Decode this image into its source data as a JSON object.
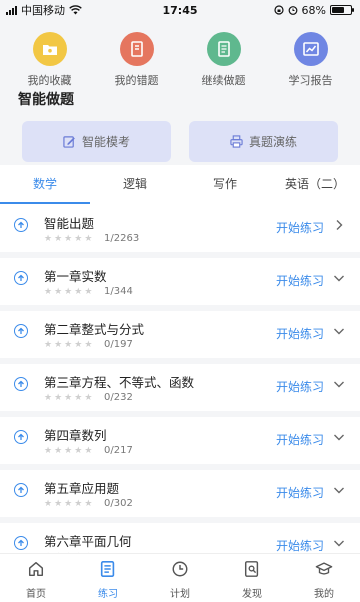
{
  "status_bar": {
    "carrier": "中国移动",
    "time": "17:45",
    "battery": "68%",
    "battery_level": 0.68
  },
  "quick_actions": [
    {
      "label": "我的收藏",
      "icon": "folder-icon",
      "color": "#f2c744"
    },
    {
      "label": "我的错题",
      "icon": "notebook-icon",
      "color": "#e5765f"
    },
    {
      "label": "继续做题",
      "icon": "document-icon",
      "color": "#5fb88e"
    },
    {
      "label": "学习报告",
      "icon": "report-icon",
      "color": "#6f86e3"
    }
  ],
  "section": {
    "title": "智能做题"
  },
  "modes": [
    {
      "label": "智能模考",
      "icon": "edit-icon"
    },
    {
      "label": "真题演练",
      "icon": "printer-icon"
    }
  ],
  "tabs": [
    "数学",
    "逻辑",
    "写作",
    "英语（二）"
  ],
  "active_tab": 0,
  "practice_items": [
    {
      "title": "智能出题",
      "progress": "1/2263",
      "action": "开始练习",
      "arrow": "right"
    },
    {
      "title": "第一章实数",
      "progress": "1/344",
      "action": "开始练习",
      "arrow": "down"
    },
    {
      "title": "第二章整式与分式",
      "progress": "0/197",
      "action": "开始练习",
      "arrow": "down"
    },
    {
      "title": "第三章方程、不等式、函数",
      "progress": "0/232",
      "action": "开始练习",
      "arrow": "down"
    },
    {
      "title": "第四章数列",
      "progress": "0/217",
      "action": "开始练习",
      "arrow": "down"
    },
    {
      "title": "第五章应用题",
      "progress": "0/302",
      "action": "开始练习",
      "arrow": "down"
    },
    {
      "title": "第六章平面几何",
      "progress": "",
      "action": "开始练习",
      "arrow": "down"
    }
  ],
  "nav": [
    {
      "label": "首页",
      "icon": "home-icon"
    },
    {
      "label": "练习",
      "icon": "practice-icon"
    },
    {
      "label": "计划",
      "icon": "clock-icon"
    },
    {
      "label": "发现",
      "icon": "discover-icon"
    },
    {
      "label": "我的",
      "icon": "profile-icon"
    }
  ],
  "active_nav": 1,
  "colors": {
    "accent": "#3b8bea",
    "background": "#f4f5f7",
    "mode_button": "#dde1f7"
  }
}
